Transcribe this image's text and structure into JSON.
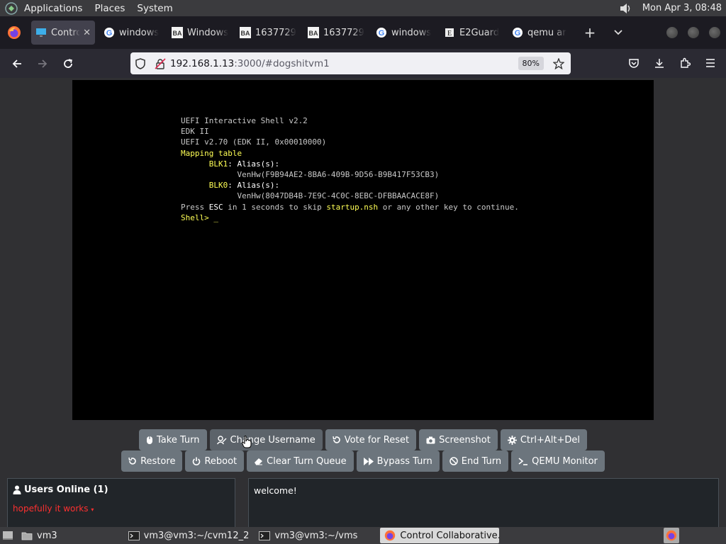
{
  "top_panel": {
    "menus": [
      "Applications",
      "Places",
      "System"
    ],
    "clock": "Mon Apr  3, 08:48"
  },
  "browser": {
    "tabs": [
      {
        "title": "Control",
        "favicon": "monitor-icon",
        "active": true
      },
      {
        "title": "windows",
        "favicon": "google-icon"
      },
      {
        "title": "Windows",
        "favicon": "ba-icon"
      },
      {
        "title": "1637729",
        "favicon": "ba-icon"
      },
      {
        "title": "1637729",
        "favicon": "ba-icon"
      },
      {
        "title": "windows",
        "favicon": "google-icon"
      },
      {
        "title": "E2Guard",
        "favicon": "wiki-icon"
      },
      {
        "title": "qemu ar",
        "favicon": "google-icon"
      }
    ],
    "url_host": "192.168.1.13",
    "url_path": ":3000/#dogshitvm1",
    "zoom": "80%"
  },
  "vm": {
    "console_lines": [
      {
        "text": "UEFI Interactive Shell v2.2",
        "color": "#c8c8c8"
      },
      {
        "text": "EDK II",
        "color": "#c8c8c8"
      },
      {
        "text": "UEFI v2.70 (EDK II, 0x00010000)",
        "color": "#c8c8c8"
      },
      {
        "text": "Mapping table",
        "color": "#ffff55"
      },
      {
        "text": "BLK1: Alias(s):",
        "indent": "      ",
        "segments": [
          {
            "t": "BLK1",
            "c": "y"
          },
          {
            "t": ": Alias(s):",
            "c": "w"
          }
        ]
      },
      {
        "text": "VenHw(F9B94AE2-8BA6-409B-9D56-B9B417F53CB3)",
        "indent": "            "
      },
      {
        "text": "BLK0: Alias(s):",
        "indent": "      ",
        "segments": [
          {
            "t": "BLK0",
            "c": "y"
          },
          {
            "t": ": Alias(s):",
            "c": "w"
          }
        ]
      },
      {
        "text": "VenHw(8047DB4B-7E9C-4C0C-8EBC-DFBBAACACE8F)",
        "indent": "            "
      },
      {
        "text": "Press ESC in 1 seconds to skip startup.nsh or any other key to continue.",
        "segments": [
          {
            "t": "Press ",
            "c": ""
          },
          {
            "t": "ESC",
            "c": "w"
          },
          {
            "t": " in 1 seconds to skip ",
            "c": ""
          },
          {
            "t": "startup.nsh",
            "c": "y"
          },
          {
            "t": " or any other key to continue.",
            "c": ""
          }
        ]
      },
      {
        "text": "Shell> _",
        "segments": [
          {
            "t": "Shell> ",
            "c": "y"
          },
          {
            "t": "_",
            "c": "y"
          }
        ]
      }
    ]
  },
  "controls": {
    "row1": [
      {
        "label": "Take Turn",
        "icon": "mouse-icon",
        "name": "take-turn-button"
      },
      {
        "label": "Change Username",
        "icon": "user-tag-icon",
        "name": "change-username-button"
      },
      {
        "label": "Vote for Reset",
        "icon": "rotate-icon",
        "name": "vote-reset-button"
      },
      {
        "label": "Screenshot",
        "icon": "camera-icon",
        "name": "screenshot-button"
      },
      {
        "label": "Ctrl+Alt+Del",
        "icon": "gear-icon",
        "name": "ctrl-alt-del-button"
      }
    ],
    "row2": [
      {
        "label": "Restore",
        "icon": "rotate-icon",
        "name": "restore-button"
      },
      {
        "label": "Reboot",
        "icon": "power-icon",
        "name": "reboot-button"
      },
      {
        "label": "Clear Turn Queue",
        "icon": "eraser-icon",
        "name": "clear-turn-queue-button"
      },
      {
        "label": "Bypass Turn",
        "icon": "fast-forward-icon",
        "name": "bypass-turn-button"
      },
      {
        "label": "End Turn",
        "icon": "ban-icon",
        "name": "end-turn-button"
      },
      {
        "label": "QEMU Monitor",
        "icon": "terminal-icon",
        "name": "qemu-monitor-button"
      }
    ]
  },
  "users": {
    "header": "Users Online (1)",
    "list": [
      "hopefully it works"
    ]
  },
  "chat": {
    "messages": [
      "welcome!"
    ]
  },
  "taskbar": {
    "items": [
      {
        "label": "vm3",
        "icon": "folder-icon"
      },
      {
        "label": "vm3@vm3:~/cvm12_2",
        "icon": "terminal-icon"
      },
      {
        "label": "vm3@vm3:~/vms",
        "icon": "terminal-icon"
      },
      {
        "label": "Control Collaborative…",
        "icon": "firefox-icon",
        "active": true
      }
    ]
  }
}
